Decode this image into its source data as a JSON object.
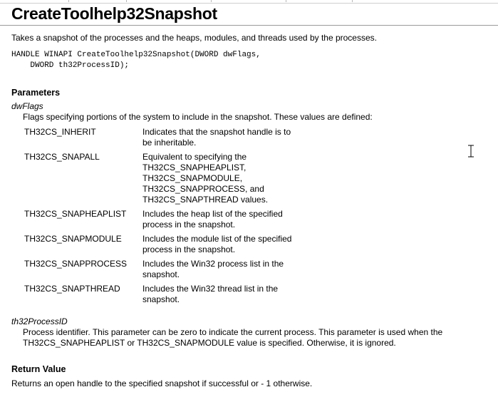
{
  "page": {
    "title": "CreateToolhelp32Snapshot",
    "description": "Takes a snapshot of the processes and the heaps, modules, and threads used by the processes.",
    "code_line1": "HANDLE WINAPI CreateToolhelp32Snapshot(DWORD dwFlags,",
    "code_line2": "    DWORD th32ProcessID);"
  },
  "parameters": {
    "heading": "Parameters",
    "dwflags": {
      "name": "dwFlags",
      "intro": "Flags specifying portions of the system to include in the snapshot. These values are defined:",
      "flags": [
        {
          "name": "TH32CS_INHERIT",
          "desc": [
            "Indicates that the snapshot handle is to",
            "be inheritable."
          ]
        },
        {
          "name": "TH32CS_SNAPALL",
          "desc": [
            "Equivalent to specifying the",
            "TH32CS_SNAPHEAPLIST,",
            "TH32CS_SNAPMODULE,",
            "TH32CS_SNAPPROCESS, and",
            "TH32CS_SNAPTHREAD values."
          ]
        },
        {
          "name": "TH32CS_SNAPHEAPLIST",
          "desc": [
            "Includes the heap list of the specified",
            "process in the snapshot."
          ]
        },
        {
          "name": "TH32CS_SNAPMODULE",
          "desc": [
            "Includes the module list of the specified",
            "process in the snapshot."
          ]
        },
        {
          "name": "TH32CS_SNAPPROCESS",
          "desc": [
            "Includes the Win32 process list in the",
            "snapshot."
          ]
        },
        {
          "name": "TH32CS_SNAPTHREAD",
          "desc": [
            "Includes the Win32 thread list in the",
            "snapshot."
          ]
        }
      ]
    },
    "th32processid": {
      "name": "th32ProcessID",
      "line1": "Process identifier. This parameter can be zero to indicate the current process. This parameter is used when the",
      "line2": "TH32CS_SNAPHEAPLIST or TH32CS_SNAPMODULE value is specified. Otherwise, it is ignored."
    }
  },
  "return_value": {
    "heading": "Return Value",
    "text": "Returns an open handle to the specified snapshot if successful or  - 1 otherwise."
  },
  "icons": {
    "cursor": "text-cursor-icon"
  }
}
